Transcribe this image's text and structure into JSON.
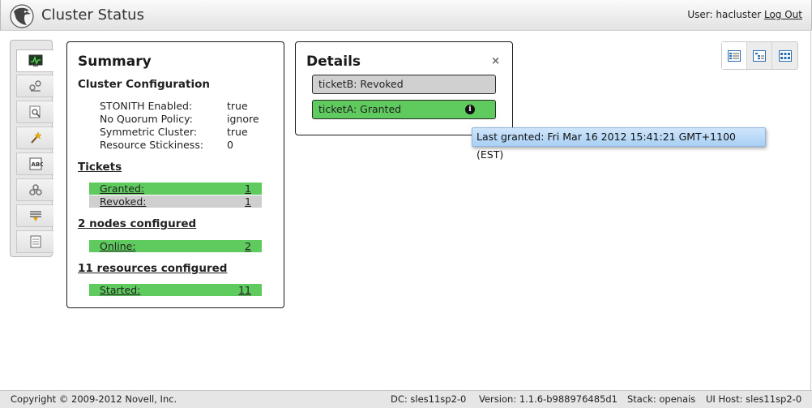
{
  "header": {
    "title": "Cluster Status",
    "user_label": "User:",
    "user_name": "hacluster",
    "logout_label": "Log Out"
  },
  "toolbar": {
    "items": [
      {
        "name": "dashboard",
        "icon": "monitor-icon",
        "active": true
      },
      {
        "name": "setup-wizard",
        "icon": "wizard-icon"
      },
      {
        "name": "history-explorer",
        "icon": "search-history-icon"
      },
      {
        "name": "simulator",
        "icon": "magic-wand-icon"
      },
      {
        "name": "resource-templates",
        "icon": "abc-template-icon"
      },
      {
        "name": "cib-settings",
        "icon": "gears-icon"
      },
      {
        "name": "access-control",
        "icon": "filter-icon"
      },
      {
        "name": "documentation",
        "icon": "document-icon"
      }
    ]
  },
  "summary": {
    "title": "Summary",
    "config_title": "Cluster Configuration",
    "config": [
      {
        "key": "STONITH Enabled:",
        "value": "true"
      },
      {
        "key": "No Quorum Policy:",
        "value": "ignore"
      },
      {
        "key": "Symmetric Cluster:",
        "value": "true"
      },
      {
        "key": "Resource Stickiness:",
        "value": "0"
      }
    ],
    "tickets_title": "Tickets",
    "tickets": [
      {
        "label": "Granted:",
        "count": "1",
        "status": "green"
      },
      {
        "label": "Revoked:",
        "count": "1",
        "status": "grey"
      }
    ],
    "nodes_title": "2 nodes configured",
    "nodes": [
      {
        "label": "Online:",
        "count": "2"
      }
    ],
    "resources_title": "11 resources configured",
    "resources": [
      {
        "label": "Started:",
        "count": "11"
      }
    ]
  },
  "details": {
    "title": "Details",
    "close_glyph": "×",
    "tickets": [
      {
        "text": "ticketB: Revoked",
        "status": "grey"
      },
      {
        "text": "ticketA: Granted",
        "status": "green"
      }
    ]
  },
  "tooltip": {
    "text": "Last granted: Fri Mar 16 2012 15:41:21 GMT+1100 (EST)"
  },
  "views": {
    "items": [
      "list-view-icon",
      "tree-view-icon",
      "grid-view-icon"
    ]
  },
  "footer": {
    "copyright": "Copyright © 2009-2012 Novell, Inc.",
    "dc": "DC: sles11sp2-0",
    "version": "Version: 1.1.6-b988976485d1",
    "stack": "Stack: openais",
    "ui_host": "UI Host: sles11sp2-0"
  },
  "colors": {
    "ok_green": "#5fcb5e",
    "revoked_grey": "#cfcfcf",
    "tooltip_blue": "#a9d0f4"
  }
}
